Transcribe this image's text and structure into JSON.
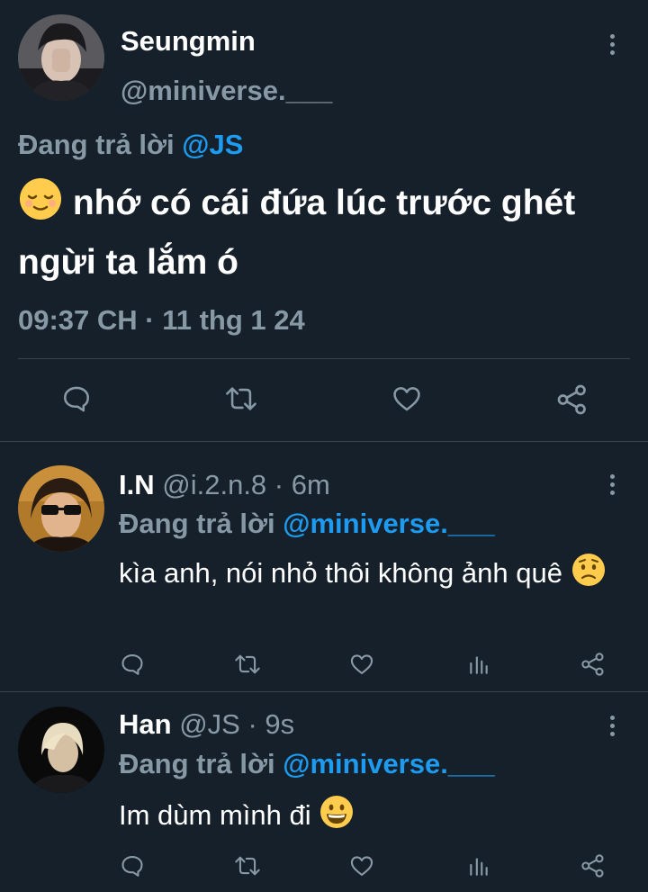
{
  "main_tweet": {
    "name": "Seungmin",
    "handle": "@miniverse.___",
    "replying_prefix": "Đang trả lời",
    "replying_to": "@JS",
    "text": "nhớ có cái đứa lúc trước ghét ngừi ta lắm ó",
    "emoji": "relieved-face",
    "timestamp": "09:37 CH · 11 thg 1 24",
    "actions": [
      "reply-icon",
      "retweet-icon",
      "like-icon",
      "share-icon"
    ]
  },
  "replies": [
    {
      "name": "I.N",
      "handle": "@i.2.n.8",
      "time": "· 6m",
      "replying_prefix": "Đang trả lời",
      "replying_to": "@miniverse.___",
      "text": "kìa anh, nói nhỏ thôi không ảnh quê",
      "emoji": "worried-face",
      "actions": [
        "reply-icon",
        "retweet-icon",
        "like-icon",
        "analytics-icon",
        "share-icon"
      ]
    },
    {
      "name": "Han",
      "handle": "@JS",
      "time": "· 9s",
      "replying_prefix": "Đang trả lời",
      "replying_to": "@miniverse.___",
      "text": "Im dùm mình đi",
      "emoji": "grinning-face",
      "actions": [
        "reply-icon",
        "retweet-icon",
        "like-icon",
        "analytics-icon",
        "share-icon"
      ]
    }
  ],
  "colors": {
    "background": "#15202b",
    "muted": "#8899a6",
    "accent": "#1d9bf0",
    "divider": "#38444d"
  }
}
